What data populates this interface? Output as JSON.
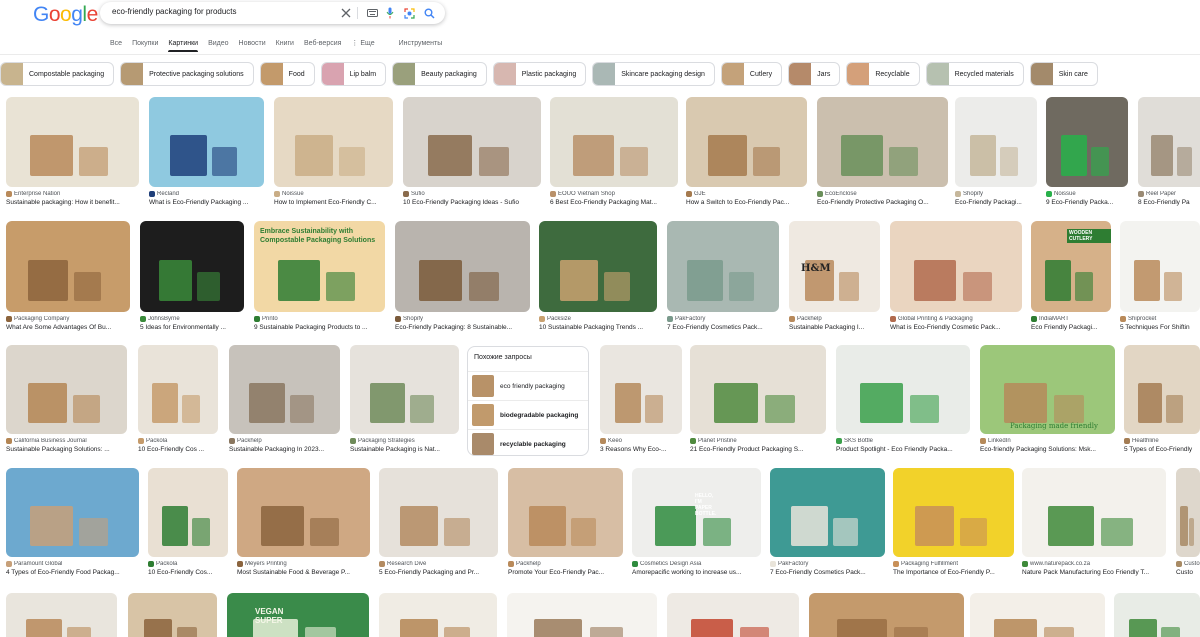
{
  "header": {
    "logo_letters": [
      {
        "c": "G",
        "color": "#4285f4"
      },
      {
        "c": "o",
        "color": "#ea4335"
      },
      {
        "c": "o",
        "color": "#fbbc05"
      },
      {
        "c": "g",
        "color": "#4285f4"
      },
      {
        "c": "l",
        "color": "#34a853"
      },
      {
        "c": "e",
        "color": "#ea4335"
      }
    ],
    "search_query": "eco-friendly packaging for products",
    "tabs": [
      {
        "label": "Все",
        "active": false
      },
      {
        "label": "Покупки",
        "active": false
      },
      {
        "label": "Картинки",
        "active": true
      },
      {
        "label": "Видео",
        "active": false
      },
      {
        "label": "Новости",
        "active": false
      },
      {
        "label": "Книги",
        "active": false
      },
      {
        "label": "Веб-версия",
        "active": false
      },
      {
        "label": "⋮ Еще",
        "active": false
      },
      {
        "label": "Инструменты",
        "active": false
      }
    ]
  },
  "chips": [
    {
      "label": "Compostable packaging",
      "color": "#c8b48e"
    },
    {
      "label": "Protective packaging solutions",
      "color": "#b69a73"
    },
    {
      "label": "Food",
      "color": "#c39a6b"
    },
    {
      "label": "Lip balm",
      "color": "#d9a3b0"
    },
    {
      "label": "Beauty packaging",
      "color": "#9aa07c"
    },
    {
      "label": "Plastic packaging",
      "color": "#d7b7b0"
    },
    {
      "label": "Skincare packaging design",
      "color": "#aab8b5"
    },
    {
      "label": "Cutlery",
      "color": "#c4a27a"
    },
    {
      "label": "Jars",
      "color": "#b58a6a"
    },
    {
      "label": "Recyclable",
      "color": "#d4a07a"
    },
    {
      "label": "Recycled materials",
      "color": "#b6c1b0"
    },
    {
      "label": "Skin care",
      "color": "#a38a6b"
    }
  ],
  "rows": [
    [
      {
        "source": "Enterprise Nation",
        "caption": "Sustainable packaging: How it benefit...",
        "bg": "#e9e3d5",
        "fg": "#b98a5a"
      },
      {
        "source": "Recland",
        "caption": "What is Eco-Friendly Packaging ...",
        "bg": "#8fc9e0",
        "fg": "#1f3f7a"
      },
      {
        "source": "Noissue",
        "caption": "How to Implement Eco-Friendly C...",
        "bg": "#e6d9c4",
        "fg": "#c9ad86"
      },
      {
        "source": "Sufio",
        "caption": "10 Eco-Friendly Packaging Ideas - Sufio",
        "bg": "#d8d3cc",
        "fg": "#8a6b4c"
      },
      {
        "source": "EOUO Vietnam Shop",
        "caption": "6 Best Eco-Friendly Packaging Mat...",
        "bg": "#e3e0d5",
        "fg": "#b9916a"
      },
      {
        "source": "GJE",
        "caption": "How a Switch to Eco-Friendly Pac...",
        "bg": "#d9c9b0",
        "fg": "#a57a4e"
      },
      {
        "source": "EcoEnclose",
        "caption": "Eco-Friendly Protective Packaging O...",
        "bg": "#cbbfae",
        "fg": "#6a8f5a"
      },
      {
        "source": "Shopify",
        "caption": "Eco-Friendly Packagi...",
        "bg": "#ececea",
        "fg": "#c6b79b"
      },
      {
        "source": "Noissue",
        "caption": "9 Eco-Friendly Packa...",
        "bg": "#6f6a60",
        "fg": "#28b04a"
      },
      {
        "source": "Reel Paper",
        "caption": "8 Eco-Friendly Pa",
        "bg": "#e0ddd8",
        "fg": "#9a8a74"
      }
    ],
    [
      {
        "source": "Packaging Company",
        "caption": "What Are Some Advantages Of Bu...",
        "bg": "#c79c6a",
        "fg": "#8c643c"
      },
      {
        "source": "JohnsByrne",
        "caption": "5 Ideas for Environmentally ...",
        "bg": "#1d1d1d",
        "fg": "#3a8a3a"
      },
      {
        "source": "Printo",
        "caption": "9 Sustainable Packaging Products to ...",
        "bg": "#f2d8a5",
        "fg": "#2e7d32"
      },
      {
        "source": "Shopify",
        "caption": "Eco-Friendly Packaging: 8 Sustainable...",
        "bg": "#b9b4ae",
        "fg": "#7a5a3a"
      },
      {
        "source": "Packsize",
        "caption": "10 Sustainable Packaging Trends ...",
        "bg": "#3e6b3e",
        "fg": "#c9a170"
      },
      {
        "source": "PakFactory",
        "caption": "7 Eco-Friendly Cosmetics Pack...",
        "bg": "#a9b8b2",
        "fg": "#7a9a8c"
      },
      {
        "source": "Packhelp",
        "caption": "Sustainable Packaging I...",
        "bg": "#efe9e1",
        "fg": "#b88a5c"
      },
      {
        "source": "Global Printing & Packaging",
        "caption": "What is Eco-Friendly Cosmetic Pack...",
        "bg": "#ead5c0",
        "fg": "#b26b4e"
      },
      {
        "source": "IndiaMART",
        "caption": "Eco Friendly Packagi...",
        "bg": "#d6b189",
        "fg": "#2e7d32"
      },
      {
        "source": "Shiprocket",
        "caption": "5 Techniques For Shiftin",
        "bg": "#f3f3f0",
        "fg": "#b98a5a"
      }
    ],
    [
      {
        "source": "California Business Journal",
        "caption": "Sustainable Packaging Solutions: ...",
        "bg": "#dcd6cc",
        "fg": "#b48654"
      },
      {
        "source": "Packola",
        "caption": "10 Eco-Friendly Cos ...",
        "bg": "#e9e3d9",
        "fg": "#c59b6b"
      },
      {
        "source": "Packhelp",
        "caption": "Sustainable Packaging In 2023...",
        "bg": "#c7c2bb",
        "fg": "#8a7760"
      },
      {
        "source": "Packaging Strategies",
        "caption": "Sustainable Packaging is Nat...",
        "bg": "#e6e2dc",
        "fg": "#6f8b5a"
      },
      {
        "source": "RELATED",
        "caption": "",
        "bg": "#fff",
        "fg": "#fff"
      },
      {
        "source": "Keeo",
        "caption": "3 Reasons Why Eco-...",
        "bg": "#eae6e0",
        "fg": "#b58a5c"
      },
      {
        "source": "Planet Pristine",
        "caption": "21 Eco-Friendly Product Packaging S...",
        "bg": "#e6e0d6",
        "fg": "#4f8a3e"
      },
      {
        "source": "SKS Bottle",
        "caption": "Product Spotlight - Eco Friendly Packa...",
        "bg": "#e9ece8",
        "fg": "#3aa04a"
      },
      {
        "source": "LinkedIn",
        "caption": "Eco-friendly Packaging Solutions: Msk...",
        "bg": "#9cc77a",
        "fg": "#b68a5a"
      },
      {
        "source": "Healthline",
        "caption": "5 Types of Eco-Friendly",
        "bg": "#e2d6c4",
        "fg": "#a47d54"
      }
    ],
    [
      {
        "source": "Paramount Global",
        "caption": "4 Types of Eco-Friendly Food Packag...",
        "bg": "#6da9cf",
        "fg": "#c7a079"
      },
      {
        "source": "Packola",
        "caption": "10 Eco-Friendly Cos...",
        "bg": "#e9e0d3",
        "fg": "#2e7d32"
      },
      {
        "source": "Meyers Printing",
        "caption": "Most Sustainable Food & Beverage P...",
        "bg": "#cfa883",
        "fg": "#8b643e"
      },
      {
        "source": "Research Dive",
        "caption": "5 Eco-Friendly Packaging and Pr...",
        "bg": "#e6e1da",
        "fg": "#b38b61"
      },
      {
        "source": "Packhelp",
        "caption": "Promote Your Eco-Friendly Pac...",
        "bg": "#d7bea4",
        "fg": "#b98a5a"
      },
      {
        "source": "Cosmetics Design Asia",
        "caption": "Amorepacific working to increase us...",
        "bg": "#eeeeec",
        "fg": "#2e8b3e"
      },
      {
        "source": "PakFactory",
        "caption": "7 Eco-Friendly Cosmetics Pack...",
        "bg": "#3e9a94",
        "fg": "#e9e4da"
      },
      {
        "source": "Packaging Fulfillment",
        "caption": "The Importance of Eco-Friendly P...",
        "bg": "#f2d22a",
        "fg": "#c89058"
      },
      {
        "source": "www.naturepack.co.za",
        "caption": "Nature Pack Manufacturing Eco Friendly T...",
        "bg": "#f3f1ec",
        "fg": "#3e8a3a"
      },
      {
        "source": "Custo",
        "caption": "Custo",
        "bg": "#ded7cc",
        "fg": "#a88a64"
      }
    ],
    [
      {
        "source": "",
        "caption": "",
        "bg": "#e9e5dd",
        "fg": "#b98a5a"
      },
      {
        "source": "",
        "caption": "",
        "bg": "#d8c4a6",
        "fg": "#8c643c"
      },
      {
        "source": "",
        "caption": "",
        "bg": "#3a8b4a",
        "fg": "#e8f0d8"
      },
      {
        "source": "",
        "caption": "",
        "bg": "#f0ece4",
        "fg": "#b48654"
      },
      {
        "source": "",
        "caption": "",
        "bg": "#f5f3ef",
        "fg": "#9a7a5a"
      },
      {
        "source": "",
        "caption": "",
        "bg": "#eeeae4",
        "fg": "#c2452e"
      },
      {
        "source": "",
        "caption": "",
        "bg": "#c49a6c",
        "fg": "#9a6e44"
      },
      {
        "source": "",
        "caption": "",
        "bg": "#f3efe8",
        "fg": "#b48654"
      },
      {
        "source": "",
        "caption": "",
        "bg": "#e8ece6",
        "fg": "#3e8a3a"
      },
      {
        "source": "",
        "caption": "",
        "bg": "#d8e8d2",
        "fg": "#1f6b2a"
      }
    ]
  ],
  "related": {
    "title": "Похожие запросы",
    "items": [
      {
        "label": "eco friendly packaging",
        "bold": false,
        "color": "#b89268"
      },
      {
        "label": "biodegradable packaging",
        "bold": true,
        "color": "#c19a6c"
      },
      {
        "label": "recyclable packaging",
        "bold": true,
        "color": "#a98a6a"
      }
    ]
  },
  "overlay_texts": {
    "embrace": "Embrace Sustainability with Compostable Packaging Solutions",
    "made_friendly": "Packaging made friendly",
    "hello_paper": "HELLO, I'M PAPER BOTTLE.",
    "eco_friendly_food": "Eco-Friendly Food",
    "vegan": "VEGAN SUPER",
    "wooden": "WOODEN CUTLERY",
    "hm": "H&M"
  }
}
